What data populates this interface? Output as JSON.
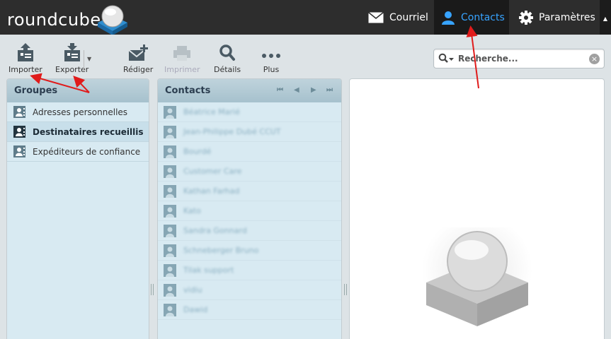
{
  "app": {
    "logo": "roundcube"
  },
  "topnav": {
    "mail": "Courriel",
    "contacts": "Contacts",
    "settings": "Paramètres"
  },
  "toolbar": {
    "import": "Importer",
    "export": "Exporter",
    "compose": "Rédiger",
    "print": "Imprimer",
    "details": "Détails",
    "more": "Plus"
  },
  "search": {
    "placeholder": "Recherche..."
  },
  "groups": {
    "title": "Groupes",
    "items": [
      {
        "label": "Adresses personnelles"
      },
      {
        "label": "Destinataires recueillis"
      },
      {
        "label": "Expéditeurs de confiance"
      }
    ]
  },
  "contacts": {
    "title": "Contacts",
    "items": [
      {
        "name": "Béatrice Marié"
      },
      {
        "name": "Jean-Philippe Dubé CCUT"
      },
      {
        "name": "Bourdé"
      },
      {
        "name": "Customer Care"
      },
      {
        "name": "Kathan Farhad"
      },
      {
        "name": "Kato"
      },
      {
        "name": "Sandra Gonnard"
      },
      {
        "name": "Schneberger Bruno"
      },
      {
        "name": "Tilak support"
      },
      {
        "name": "vidiu"
      },
      {
        "name": "Dawid"
      }
    ]
  },
  "colors": {
    "accent": "#37a3ff",
    "topbar": "#2d2d2d",
    "panel_head": "#a6c1cd",
    "arrow": "#e01b1b"
  }
}
